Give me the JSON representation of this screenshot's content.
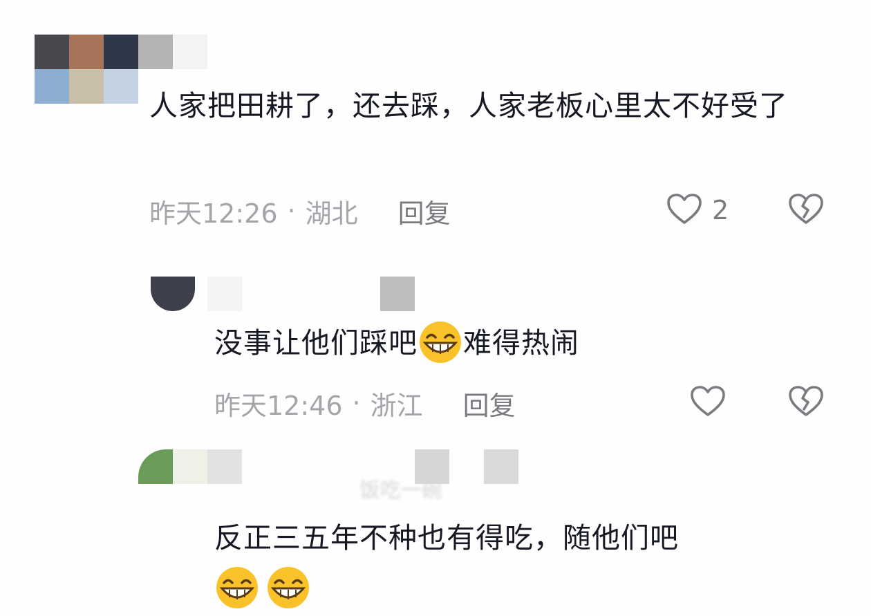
{
  "comments": [
    {
      "text": "人家把田耕了，还去踩，人家老板心里太不好受了",
      "time": "昨天12:26",
      "separator": "·",
      "location": "湖北",
      "reply_label": "回复",
      "like_count": "2"
    },
    {
      "text_before_emoji": "没事让他们踩吧",
      "text_after_emoji": "难得热闹",
      "time": "昨天12:46",
      "separator": "·",
      "location": "浙江",
      "reply_label": "回复",
      "like_count": ""
    },
    {
      "masked_username": "饭吃一碗",
      "text": "反正三五年不种也有得吃，随他们吧"
    }
  ],
  "icons": {
    "like": "heart-outline-icon",
    "dislike": "broken-heart-icon",
    "emoji": "grinning-face-emoji"
  },
  "colors": {
    "text": "#161823",
    "meta": "#a4a5aa",
    "reply": "#7a7b80",
    "icon": "#7a7b80",
    "emoji_yellow": "#f9c22a"
  }
}
